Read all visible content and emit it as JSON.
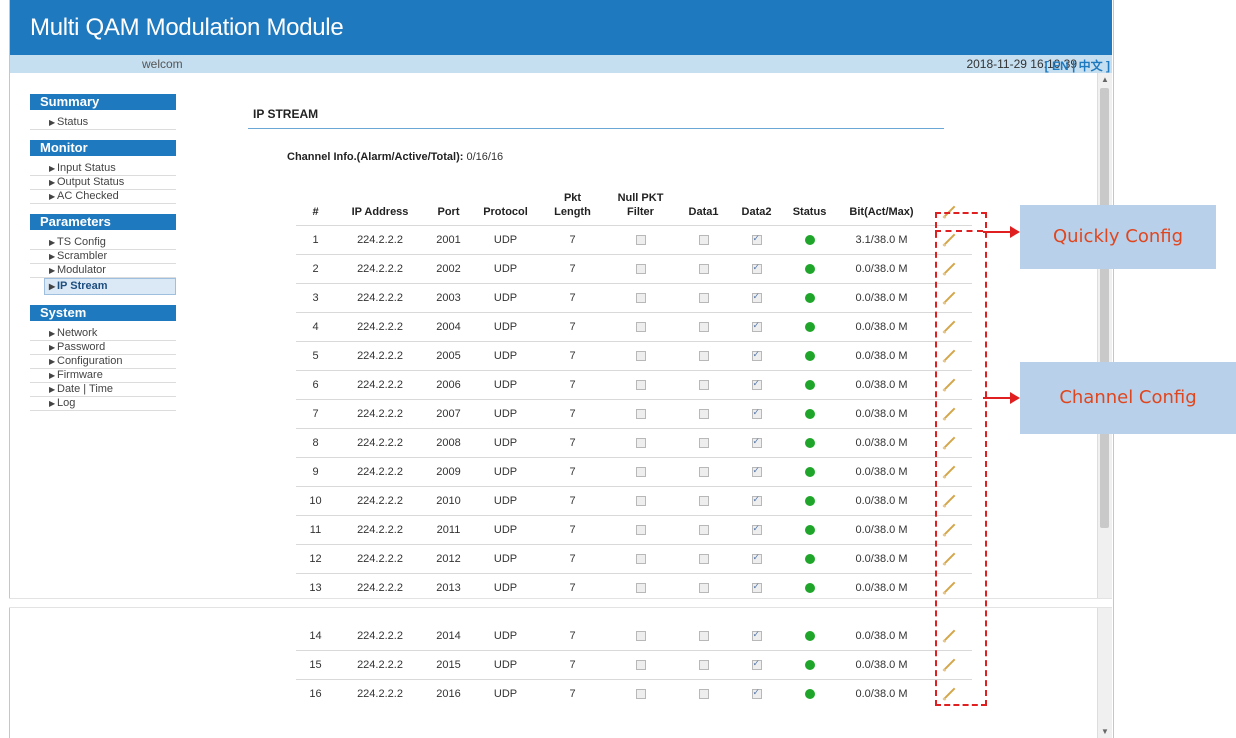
{
  "app": {
    "title": "Multi QAM Modulation Module",
    "welcome": "welcom",
    "datetime": "2018-11-29 16:10:39",
    "lang": "[ EN | 中文 ]"
  },
  "sidebar": {
    "sections": [
      {
        "header": "Summary",
        "items": [
          "Status"
        ]
      },
      {
        "header": "Monitor",
        "items": [
          "Input Status",
          "Output Status",
          "AC Checked"
        ]
      },
      {
        "header": "Parameters",
        "items": [
          "TS Config",
          "Scrambler",
          "Modulator",
          "IP Stream"
        ]
      },
      {
        "header": "System",
        "items": [
          "Network",
          "Password",
          "Configuration",
          "Firmware",
          "Date | Time",
          "Log"
        ]
      }
    ],
    "active_item": "IP Stream"
  },
  "main": {
    "page_title": "IP STREAM",
    "channel_info_label": "Channel Info.(Alarm/Active/Total):",
    "channel_info_value": " 0/16/16",
    "columns": [
      "#",
      "IP Address",
      "Port",
      "Protocol",
      "Pkt\nLength",
      "Null PKT\nFilter",
      "Data1",
      "Data2",
      "Status",
      "Bit(Act/Max)"
    ],
    "rows": [
      {
        "n": "1",
        "ip": "224.2.2.2",
        "port": "2001",
        "proto": "UDP",
        "pkt": "7",
        "null_filter": false,
        "data1": false,
        "data2": true,
        "status": "ok",
        "bit": "3.1/38.0 M"
      },
      {
        "n": "2",
        "ip": "224.2.2.2",
        "port": "2002",
        "proto": "UDP",
        "pkt": "7",
        "null_filter": false,
        "data1": false,
        "data2": true,
        "status": "ok",
        "bit": "0.0/38.0 M"
      },
      {
        "n": "3",
        "ip": "224.2.2.2",
        "port": "2003",
        "proto": "UDP",
        "pkt": "7",
        "null_filter": false,
        "data1": false,
        "data2": true,
        "status": "ok",
        "bit": "0.0/38.0 M"
      },
      {
        "n": "4",
        "ip": "224.2.2.2",
        "port": "2004",
        "proto": "UDP",
        "pkt": "7",
        "null_filter": false,
        "data1": false,
        "data2": true,
        "status": "ok",
        "bit": "0.0/38.0 M"
      },
      {
        "n": "5",
        "ip": "224.2.2.2",
        "port": "2005",
        "proto": "UDP",
        "pkt": "7",
        "null_filter": false,
        "data1": false,
        "data2": true,
        "status": "ok",
        "bit": "0.0/38.0 M"
      },
      {
        "n": "6",
        "ip": "224.2.2.2",
        "port": "2006",
        "proto": "UDP",
        "pkt": "7",
        "null_filter": false,
        "data1": false,
        "data2": true,
        "status": "ok",
        "bit": "0.0/38.0 M"
      },
      {
        "n": "7",
        "ip": "224.2.2.2",
        "port": "2007",
        "proto": "UDP",
        "pkt": "7",
        "null_filter": false,
        "data1": false,
        "data2": true,
        "status": "ok",
        "bit": "0.0/38.0 M"
      },
      {
        "n": "8",
        "ip": "224.2.2.2",
        "port": "2008",
        "proto": "UDP",
        "pkt": "7",
        "null_filter": false,
        "data1": false,
        "data2": true,
        "status": "ok",
        "bit": "0.0/38.0 M"
      },
      {
        "n": "9",
        "ip": "224.2.2.2",
        "port": "2009",
        "proto": "UDP",
        "pkt": "7",
        "null_filter": false,
        "data1": false,
        "data2": true,
        "status": "ok",
        "bit": "0.0/38.0 M"
      },
      {
        "n": "10",
        "ip": "224.2.2.2",
        "port": "2010",
        "proto": "UDP",
        "pkt": "7",
        "null_filter": false,
        "data1": false,
        "data2": true,
        "status": "ok",
        "bit": "0.0/38.0 M"
      },
      {
        "n": "11",
        "ip": "224.2.2.2",
        "port": "2011",
        "proto": "UDP",
        "pkt": "7",
        "null_filter": false,
        "data1": false,
        "data2": true,
        "status": "ok",
        "bit": "0.0/38.0 M"
      },
      {
        "n": "12",
        "ip": "224.2.2.2",
        "port": "2012",
        "proto": "UDP",
        "pkt": "7",
        "null_filter": false,
        "data1": false,
        "data2": true,
        "status": "ok",
        "bit": "0.0/38.0 M"
      },
      {
        "n": "13",
        "ip": "224.2.2.2",
        "port": "2013",
        "proto": "UDP",
        "pkt": "7",
        "null_filter": false,
        "data1": false,
        "data2": true,
        "status": "ok",
        "bit": "0.0/38.0 M"
      },
      {
        "n": "14",
        "ip": "224.2.2.2",
        "port": "2014",
        "proto": "UDP",
        "pkt": "7",
        "null_filter": false,
        "data1": false,
        "data2": true,
        "status": "ok",
        "bit": "0.0/38.0 M"
      },
      {
        "n": "15",
        "ip": "224.2.2.2",
        "port": "2015",
        "proto": "UDP",
        "pkt": "7",
        "null_filter": false,
        "data1": false,
        "data2": true,
        "status": "ok",
        "bit": "0.0/38.0 M"
      },
      {
        "n": "16",
        "ip": "224.2.2.2",
        "port": "2016",
        "proto": "UDP",
        "pkt": "7",
        "null_filter": false,
        "data1": false,
        "data2": true,
        "status": "ok",
        "bit": "0.0/38.0 M"
      }
    ]
  },
  "annotations": {
    "quick_config": "Quickly Config",
    "channel_config": "Channel Config"
  },
  "colors": {
    "header_bg": "#1f79be",
    "subbar_bg": "#c5def0",
    "status_ok": "#1fa62a",
    "annotation_red": "#e02020",
    "callout_bg": "#b8d0ea"
  }
}
